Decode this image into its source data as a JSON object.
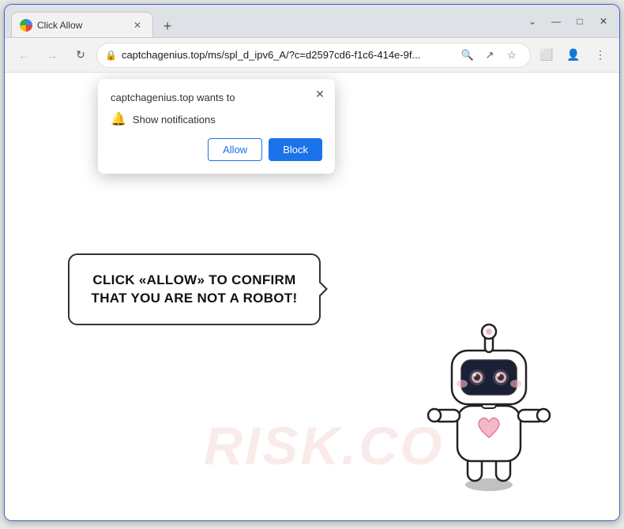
{
  "browser": {
    "tab": {
      "title": "Click Allow",
      "favicon": "globe"
    },
    "new_tab_label": "+",
    "window_controls": {
      "chevron_down": "⌄",
      "minimize": "—",
      "maximize": "□",
      "close": "✕"
    },
    "nav": {
      "back_label": "←",
      "forward_label": "→",
      "reload_label": "↻",
      "address": "captchagenius.top/ms/spl_d_ipv6_A/?c=d2597cd6-f1c6-414e-9f...",
      "lock_icon": "🔒",
      "search_icon": "🔍",
      "share_icon": "↗",
      "star_icon": "☆",
      "tab_icon": "⬜",
      "profile_icon": "👤",
      "menu_icon": "⋮"
    }
  },
  "notification_popup": {
    "header": "captchagenius.top wants to",
    "close_label": "✕",
    "bell_icon": "🔔",
    "notification_text": "Show notifications",
    "allow_label": "Allow",
    "block_label": "Block"
  },
  "page": {
    "bubble_text": "CLICK «ALLOW» TO CONFIRM THAT YOU ARE NOT A ROBOT!",
    "watermark": "RISK.CO"
  }
}
